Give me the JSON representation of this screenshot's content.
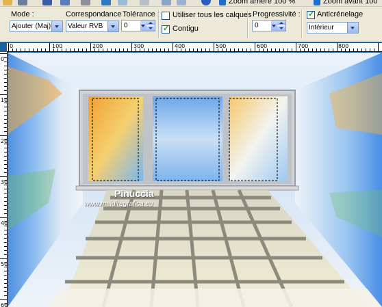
{
  "toolbar": {
    "zoom_out_label": "Zoom arrière 100 %",
    "zoom_in_label": "Zoom avant 100"
  },
  "options": {
    "mode_label": "Mode :",
    "mode_value": "Ajouter (Maj)",
    "correspondance_label": "Correspondance :",
    "correspondance_value": "Valeur RVB",
    "tolerance_label": "Tolérance :",
    "tolerance_value": "0",
    "use_all_layers_label": "Utiliser tous les calques",
    "use_all_layers_checked": false,
    "contigu_label": "Contigu",
    "contigu_checked": true,
    "progressivite_label": "Progressivité :",
    "progressivite_value": "0",
    "anticrenelage_label": "Anticrénelage",
    "anticrenelage_checked": true,
    "anticrenelage_mode": "Intérieur"
  },
  "ruler": {
    "h_labels": [
      "0",
      "100",
      "200",
      "300",
      "400",
      "500",
      "600",
      "700",
      "800"
    ],
    "v_labels": [
      "0",
      "100",
      "200",
      "300",
      "400",
      "500",
      "600"
    ]
  },
  "canvas": {
    "watermark_title": "Pinuccia",
    "watermark_url": "www.maidiregrafica.eu"
  },
  "colors": {
    "window_bg": "#ece9d8",
    "canvas_border": "#1d5f9f",
    "selection_marquee": "#000000"
  }
}
